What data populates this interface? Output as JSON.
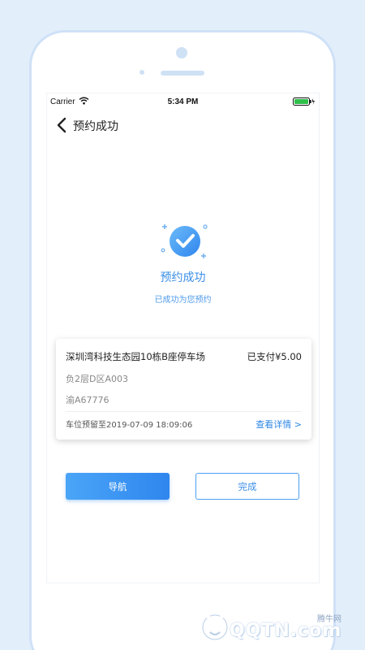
{
  "colors": {
    "accent": "#3a8ee8",
    "background": "#e3eefb",
    "primary_button": "#2f86ee"
  },
  "status_bar": {
    "carrier": "Carrier",
    "time": "5:34 PM",
    "icons": [
      "wifi-icon",
      "battery-icon"
    ]
  },
  "nav": {
    "title": "预约成功",
    "back_icon": "chevron-left-icon"
  },
  "result": {
    "icon": "check-circle-icon",
    "title": "预约成功",
    "subtitle": "已成功为您预约"
  },
  "card": {
    "lot_name": "深圳湾科技生态园10栋B座停车场",
    "paid": "已支付¥5.00",
    "floor": "负2层D区A003",
    "plate": "渝A67776",
    "reserved_until": "车位预留至2019-07-09 18:09:06",
    "detail_link": "查看详情 >"
  },
  "buttons": {
    "navigate": "导航",
    "done": "完成"
  },
  "watermark": {
    "brand": "QQTN.com",
    "cn": "腾牛网"
  }
}
